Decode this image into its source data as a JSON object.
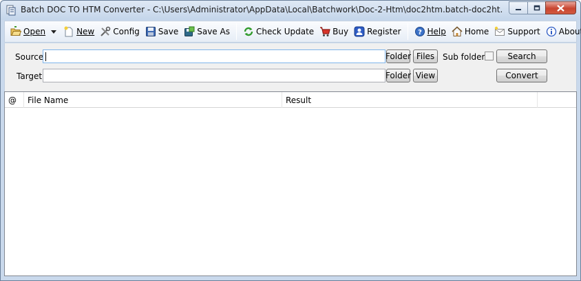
{
  "window": {
    "title": "Batch DOC TO HTM Converter - C:\\Users\\Administrator\\AppData\\Local\\Batchwork\\Doc-2-Htm\\doc2htm.batch-doc2ht..."
  },
  "toolbar": {
    "open": "Open",
    "new": "New",
    "config": "Config",
    "save": "Save",
    "save_as": "Save As",
    "check_update": "Check Update",
    "buy": "Buy",
    "register": "Register",
    "help": "Help",
    "home": "Home",
    "support": "Support",
    "about": "About"
  },
  "form": {
    "source_label": "Source",
    "source_value": "",
    "target_label": "Target",
    "target_value": "",
    "folder_button": "Folder",
    "files_button": "Files",
    "view_button": "View",
    "subfolders_label": "Sub folders",
    "subfolders_checked": false,
    "search_button": "Search",
    "convert_button": "Convert"
  },
  "list": {
    "columns": [
      "@",
      "File Name",
      "Result"
    ],
    "rows": []
  },
  "colors": {
    "window_frame": "#c9d9ec",
    "close_button": "#c8452f",
    "panel_bg": "#f0f0f0"
  }
}
